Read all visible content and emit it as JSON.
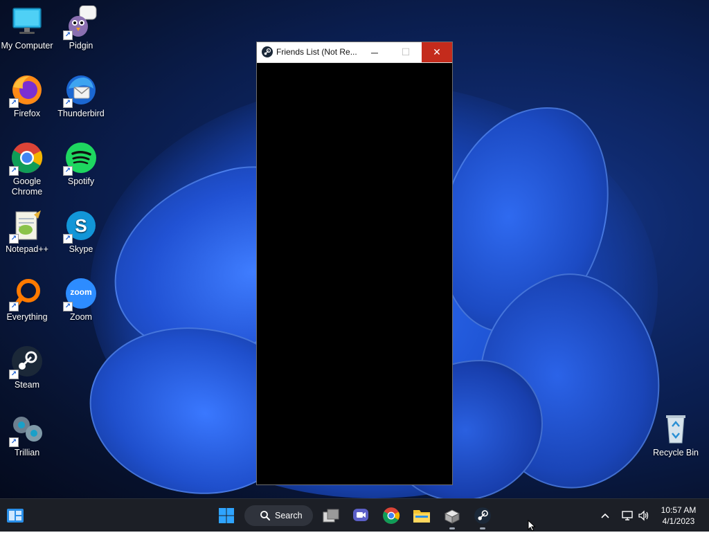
{
  "desktop": {
    "icons": [
      {
        "id": "my-computer",
        "label": "My Computer",
        "icon": "monitor-icon"
      },
      {
        "id": "pidgin",
        "label": "Pidgin",
        "icon": "pidgin-icon"
      },
      {
        "id": "firefox",
        "label": "Firefox",
        "icon": "firefox-icon"
      },
      {
        "id": "thunderbird",
        "label": "Thunderbird",
        "icon": "thunderbird-icon"
      },
      {
        "id": "google-chrome",
        "label": "Google\nChrome",
        "icon": "chrome-icon"
      },
      {
        "id": "spotify",
        "label": "Spotify",
        "icon": "spotify-icon"
      },
      {
        "id": "notepadpp",
        "label": "Notepad++",
        "icon": "notepadpp-icon"
      },
      {
        "id": "skype",
        "label": "Skype",
        "icon": "skype-icon"
      },
      {
        "id": "everything",
        "label": "Everything",
        "icon": "everything-icon"
      },
      {
        "id": "zoom",
        "label": "Zoom",
        "icon": "zoom-icon",
        "badge_text": "zoom"
      },
      {
        "id": "steam",
        "label": "Steam",
        "icon": "steam-icon"
      },
      {
        "id": "trillian",
        "label": "Trillian",
        "icon": "trillian-icon"
      }
    ],
    "recycle_bin": {
      "label": "Recycle Bin",
      "icon": "recycle-bin-icon"
    }
  },
  "window": {
    "title": "Friends List (Not Re...",
    "minimize_glyph": "─",
    "maximize_glyph": "☐",
    "close_glyph": "✕"
  },
  "taskbar": {
    "search_label": "Search",
    "items": [
      "start-icon",
      "search",
      "task-view-icon",
      "meet-icon",
      "chrome-icon",
      "file-explorer-icon",
      "installer-icon",
      "steam-icon"
    ],
    "clock": {
      "time": "10:57 AM",
      "date": "4/1/2023"
    }
  },
  "colors": {
    "close_button": "#c42b1c",
    "taskbar": "#1c1f26",
    "window_client": "#000000"
  }
}
